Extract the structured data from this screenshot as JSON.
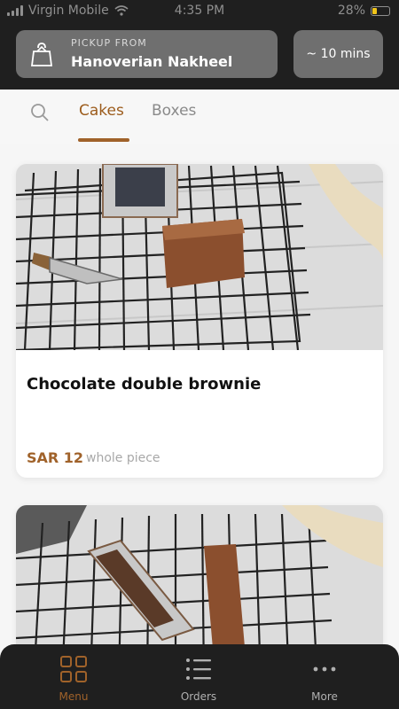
{
  "status_bar": {
    "carrier": "Virgin Mobile",
    "time": "4:35 PM",
    "battery": "28%",
    "battery_level": 0.28
  },
  "header": {
    "pickup_label": "PICKUP FROM",
    "pickup_location": "Hanoverian Nakheel",
    "eta": "~ 10 mins"
  },
  "tabs": [
    {
      "label": "Cakes",
      "selected": true
    },
    {
      "label": "Boxes",
      "selected": false
    }
  ],
  "products": [
    {
      "name": "Chocolate double brownie",
      "price": "SAR 12",
      "unit": "whole piece"
    }
  ],
  "bottom_nav": [
    {
      "label": "Menu",
      "icon": "grid-icon",
      "selected": true
    },
    {
      "label": "Orders",
      "icon": "list-icon",
      "selected": false
    },
    {
      "label": "More",
      "icon": "more-icon",
      "selected": false
    }
  ],
  "colors": {
    "accent": "#a0622a",
    "header_bg": "#1f1f1f",
    "pill_bg": "#6f6f6f",
    "battery_fill": "#f0c419"
  }
}
